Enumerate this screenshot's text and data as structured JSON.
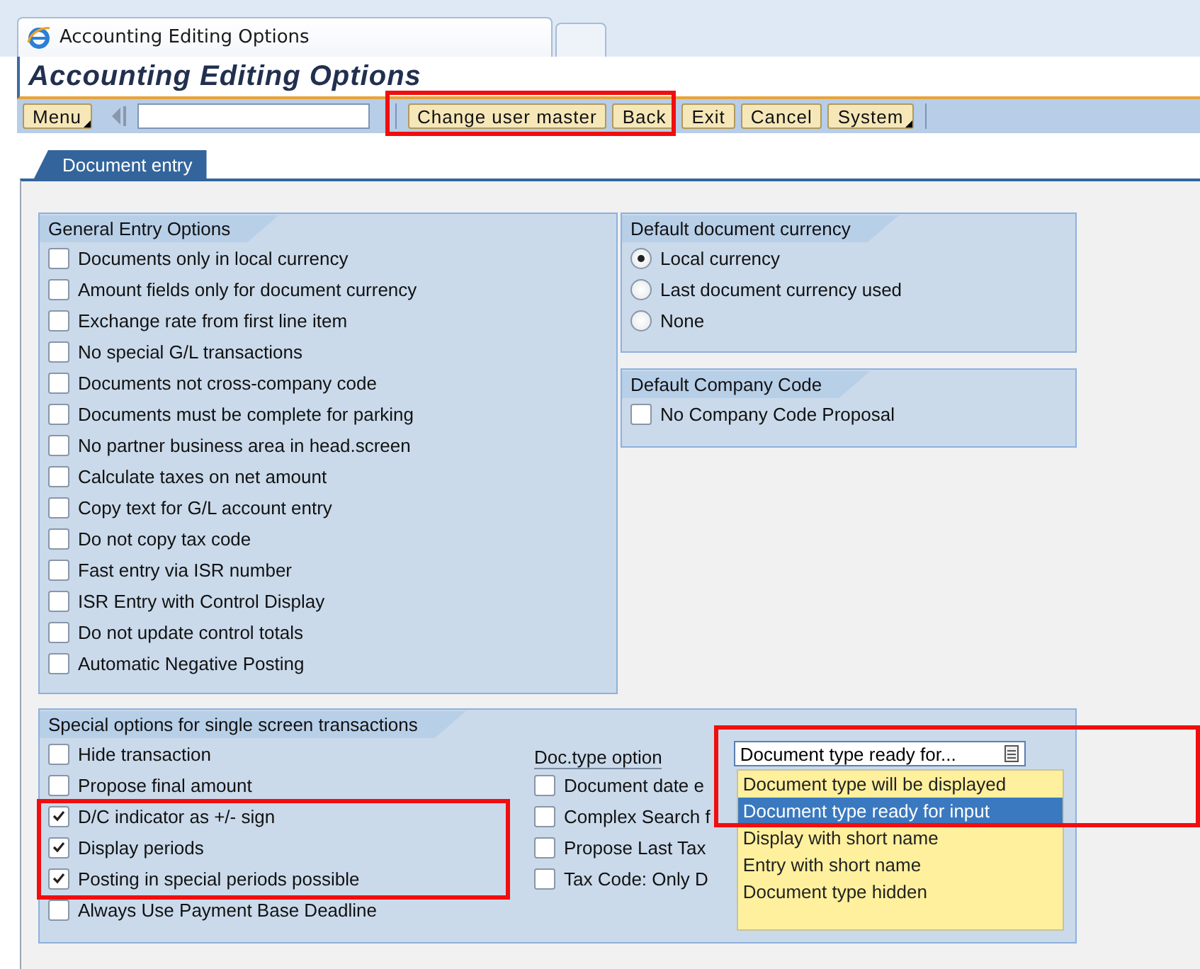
{
  "browser_tabs": [
    {
      "title": "Accounting Editing Options",
      "selected": true
    },
    {
      "selected": false
    }
  ],
  "title": "Accounting Editing Options",
  "toolbar": {
    "items": [
      {
        "label": "Menu",
        "kind": "menu"
      },
      {
        "kind": "back_arrow"
      },
      {
        "kind": "command_field"
      },
      {
        "kind": "separator"
      },
      {
        "label": "Change user master",
        "kind": "button"
      },
      {
        "label": "Back",
        "kind": "button"
      },
      {
        "label": "Exit",
        "kind": "button"
      },
      {
        "label": "Cancel",
        "kind": "button"
      },
      {
        "label": "System",
        "kind": "menu"
      },
      {
        "kind": "separator"
      }
    ]
  },
  "tabs": [
    {
      "label": "Document entry",
      "selected": true
    }
  ],
  "general_entry_options": {
    "title": "General Entry Options",
    "options": [
      {
        "label": "Documents only in local currency",
        "checked": false
      },
      {
        "label": "Amount fields only for document currency",
        "checked": false
      },
      {
        "label": "Exchange rate from first line item",
        "checked": false
      },
      {
        "label": "No special G/L transactions",
        "checked": false
      },
      {
        "label": "Documents not cross-company code",
        "checked": false
      },
      {
        "label": "Documents must be complete for parking",
        "checked": false
      },
      {
        "label": "No partner business area in head.screen",
        "checked": false
      },
      {
        "label": "Calculate taxes on net amount",
        "checked": false
      },
      {
        "label": "Copy text for G/L account entry",
        "checked": false
      },
      {
        "label": "Do not copy tax code",
        "checked": false
      },
      {
        "label": "Fast entry via ISR number",
        "checked": false
      },
      {
        "label": "ISR Entry with Control Display",
        "checked": false
      },
      {
        "label": "Do not update control totals",
        "checked": false
      },
      {
        "label": "Automatic Negative Posting",
        "checked": false
      }
    ]
  },
  "default_document_currency": {
    "title": "Default document currency",
    "options": [
      {
        "label": "Local currency",
        "selected": true
      },
      {
        "label": "Last document currency used",
        "selected": false
      },
      {
        "label": "None",
        "selected": false
      }
    ]
  },
  "default_company_code": {
    "title": "Default Company Code",
    "options": [
      {
        "label": "No Company Code Proposal",
        "checked": false
      }
    ]
  },
  "special_options": {
    "title": "Special options for single screen transactions",
    "left_options": [
      {
        "label": "Hide transaction",
        "checked": false
      },
      {
        "label": "Propose final amount",
        "checked": false
      },
      {
        "label": "D/C indicator as +/- sign",
        "checked": true
      },
      {
        "label": "Display periods",
        "checked": true
      },
      {
        "label": "Posting in special periods possible",
        "checked": true
      },
      {
        "label": "Always Use Payment Base Deadline",
        "checked": false
      }
    ],
    "doc_type": {
      "label": "Doc.type option",
      "value": "Document type ready for...",
      "expanded": true,
      "choices": [
        {
          "label": "Document type will be displayed",
          "selected": false
        },
        {
          "label": "Document type ready for input",
          "selected": true
        },
        {
          "label": "Display with short name",
          "selected": false
        },
        {
          "label": "Entry with short name",
          "selected": false
        },
        {
          "label": "Document type hidden",
          "selected": false
        }
      ]
    },
    "right_options": [
      {
        "label": "Document date e",
        "checked": false
      },
      {
        "label": "Complex Search f",
        "checked": false
      },
      {
        "label": "Propose Last Tax",
        "checked": false
      },
      {
        "label": "Tax Code: Only D",
        "checked": false
      }
    ]
  }
}
